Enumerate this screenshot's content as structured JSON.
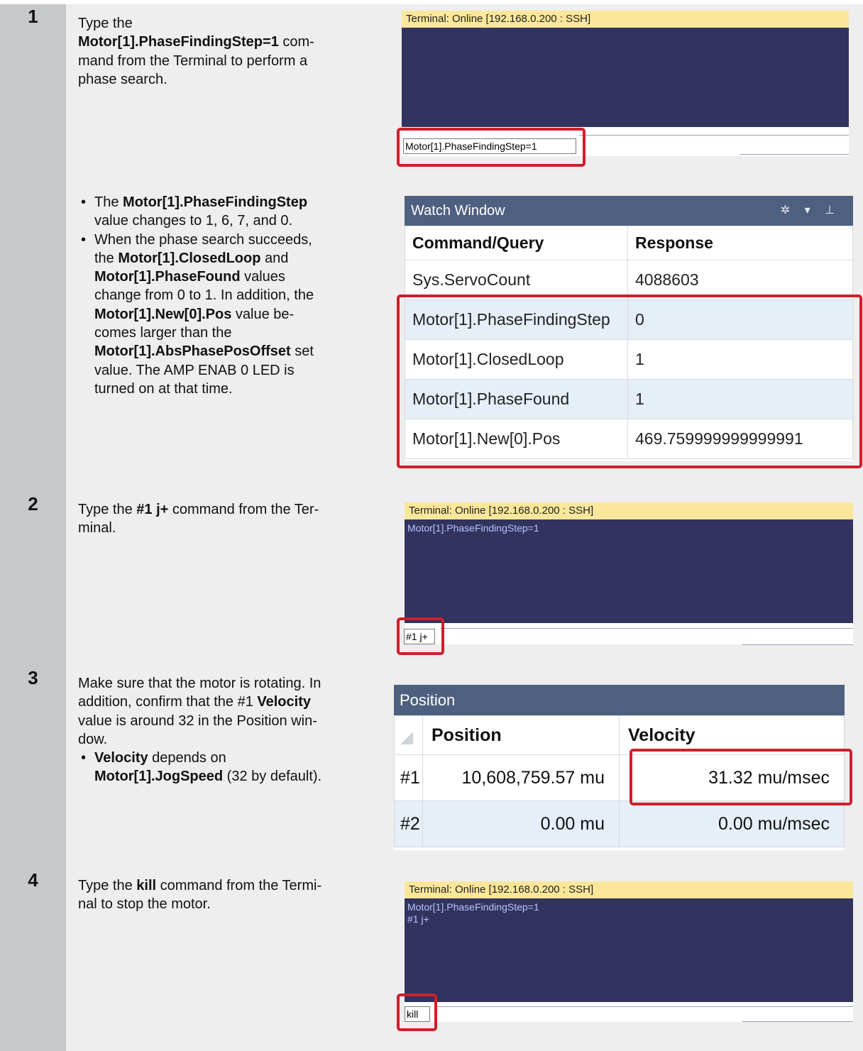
{
  "steps": [
    {
      "number": "1",
      "text": {
        "p1": "Type the",
        "p2_bold": "Motor[1].PhaseFindingStep=1",
        "p2_rest": " com-",
        "p3": "mand from the Terminal to perform a",
        "p4": "phase search."
      },
      "bullets": {
        "b1_pre": "The ",
        "b1_bold": "Motor[1].PhaseFindingStep",
        "b1_line2": "value changes to 1, 6, 7, and 0.",
        "b2_line1": "When the phase search succeeds,",
        "b2_pre": "the ",
        "b2_bold1": "Motor[1].ClosedLoop",
        "b2_and": " and",
        "b2_bold2": "Motor[1].PhaseFound",
        "b2_values": " values",
        "b2_line5": "change from 0 to 1. In addition, the",
        "b2_bold3": "Motor[1].New[0].Pos",
        "b2_valuebe": " value be-",
        "b2_line7": "comes larger than the",
        "b2_bold4": "Motor[1].AbsPhasePosOffset",
        "b2_set": " set",
        "b2_line9": "value. The AMP ENAB 0 LED is",
        "b2_line10": "turned on at that time."
      },
      "terminal": {
        "title": "Terminal: Online [192.168.0.200 : SSH]",
        "input": "Motor[1].PhaseFindingStep=1"
      },
      "watch": {
        "title": "Watch Window",
        "controls": "✲ ▾ ⊥",
        "headers": [
          "Command/Query",
          "Response"
        ],
        "rows": [
          [
            "Sys.ServoCount",
            "4088603"
          ],
          [
            "Motor[1].PhaseFindingStep",
            "0"
          ],
          [
            "Motor[1].ClosedLoop",
            "1"
          ],
          [
            "Motor[1].PhaseFound",
            "1"
          ],
          [
            "Motor[1].New[0].Pos",
            "469.759999999999991"
          ]
        ]
      }
    },
    {
      "number": "2",
      "text": {
        "pre": "Type the ",
        "bold": "#1 j+",
        "post": " command from the Ter-",
        "line2": "minal."
      },
      "terminal": {
        "title": "Terminal: Online [192.168.0.200 : SSH]",
        "lines": [
          "Motor[1].PhaseFindingStep=1"
        ],
        "input": "#1 j+"
      }
    },
    {
      "number": "3",
      "text": {
        "l1": "Make sure that the motor is rotating. In",
        "l2_pre": "addition, confirm that the #1 ",
        "l2_bold": "Velocity",
        "l3": "value is around 32 in the Position win-",
        "l4": "dow.",
        "b1_bold": "Velocity",
        "b1_rest": " depends on",
        "b2_bold": "Motor[1].JogSpeed",
        "b2_rest": " (32 by default)."
      },
      "position": {
        "title": "Position",
        "headers": [
          "Position",
          "Velocity"
        ],
        "rows": [
          [
            "#1",
            "10,608,759.57 mu",
            "31.32 mu/msec"
          ],
          [
            "#2",
            "0.00 mu",
            "0.00 mu/msec"
          ]
        ]
      }
    },
    {
      "number": "4",
      "text": {
        "pre": "Type the ",
        "bold": "kill",
        "post": " command from the Termi-",
        "line2": "nal to stop the motor."
      },
      "terminal": {
        "title": "Terminal: Online [192.168.0.200 : SSH]",
        "lines": [
          "Motor[1].PhaseFindingStep=1",
          "#1 j+"
        ],
        "input": "kill"
      }
    }
  ],
  "bullet_char": "•",
  "colors": {
    "highlight_red": "#d01f2b",
    "terminal_title_yellow": "#fbe79a",
    "terminal_body_navy": "#32335e",
    "window_title_blue": "#4e6080"
  }
}
